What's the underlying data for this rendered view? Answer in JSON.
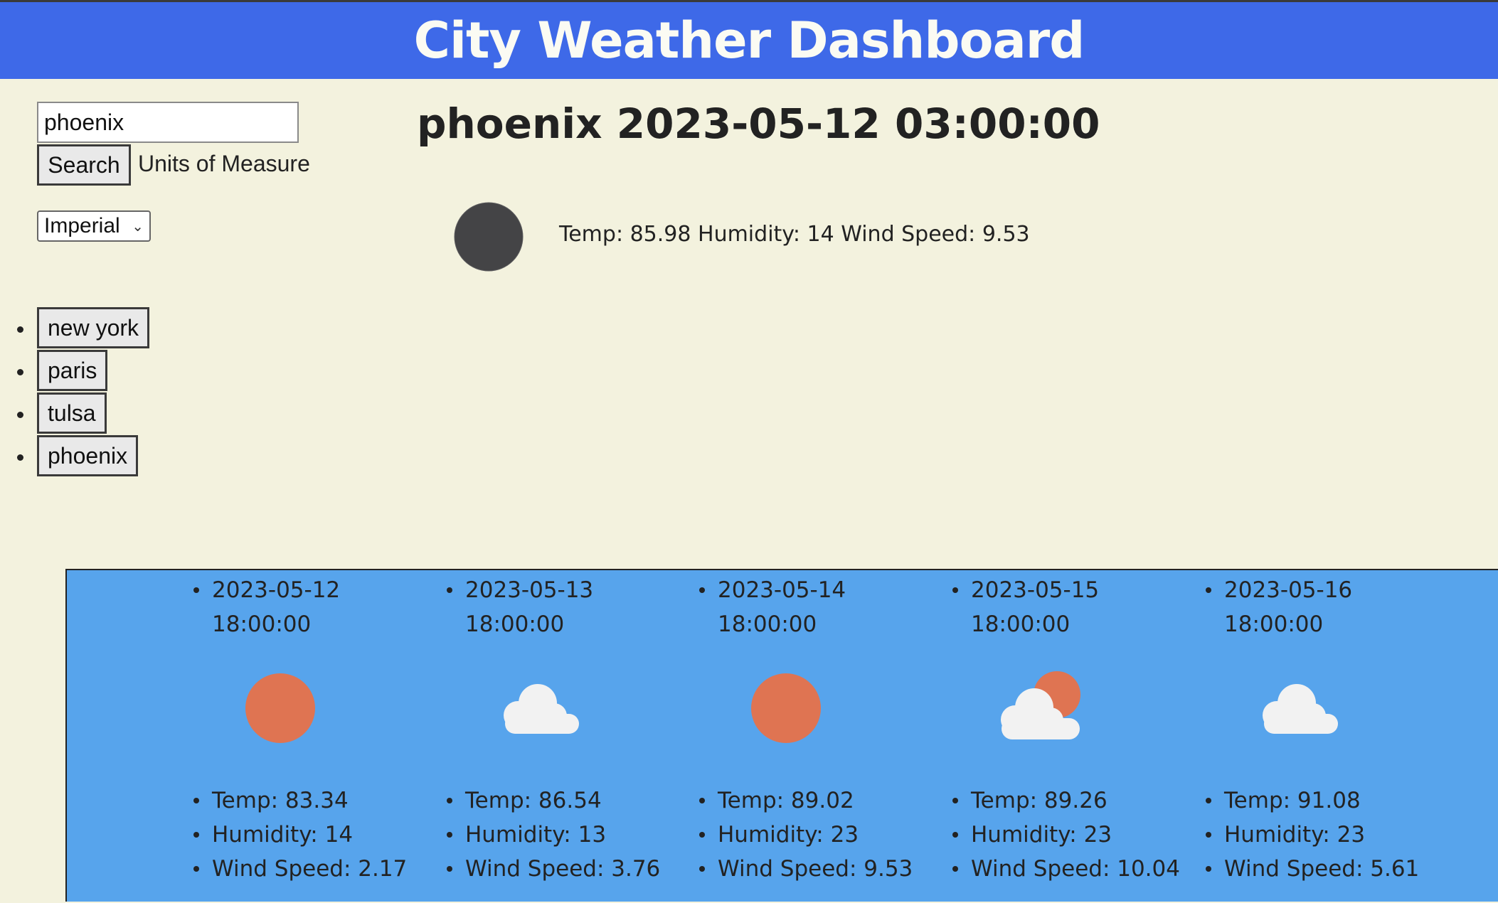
{
  "header": {
    "title": "City Weather Dashboard"
  },
  "search": {
    "value": "phoenix",
    "button_label": "Search"
  },
  "units": {
    "label": "Units of Measure",
    "selected": "Imperial"
  },
  "history": [
    "new york",
    "paris",
    "tulsa",
    "phoenix"
  ],
  "current": {
    "title": "phoenix 2023-05-12 03:00:00",
    "icon": "moon-icon",
    "stats": "Temp: 85.98 Humidity: 14 Wind Speed: 9.53"
  },
  "forecast": [
    {
      "date": "2023-05-12 18:00:00",
      "icon": "sun-icon",
      "temp": "Temp: 83.34",
      "humidity": "Humidity: 14",
      "wind": "Wind Speed: 2.17"
    },
    {
      "date": "2023-05-13 18:00:00",
      "icon": "cloud-icon",
      "temp": "Temp: 86.54",
      "humidity": "Humidity: 13",
      "wind": "Wind Speed: 3.76"
    },
    {
      "date": "2023-05-14 18:00:00",
      "icon": "sun-icon",
      "temp": "Temp: 89.02",
      "humidity": "Humidity: 23",
      "wind": "Wind Speed: 9.53"
    },
    {
      "date": "2023-05-15 18:00:00",
      "icon": "partly-cloudy-icon",
      "temp": "Temp: 89.26",
      "humidity": "Humidity: 23",
      "wind": "Wind Speed: 10.04"
    },
    {
      "date": "2023-05-16 18:00:00",
      "icon": "cloud-icon",
      "temp": "Temp: 91.08",
      "humidity": "Humidity: 23",
      "wind": "Wind Speed: 5.61"
    }
  ],
  "colors": {
    "header_bg": "#3e69e8",
    "page_bg": "#f3f2de",
    "forecast_bg": "#57a4ec",
    "sun": "#df7452",
    "cloud": "#f2f2f2",
    "moon": "#444446"
  }
}
